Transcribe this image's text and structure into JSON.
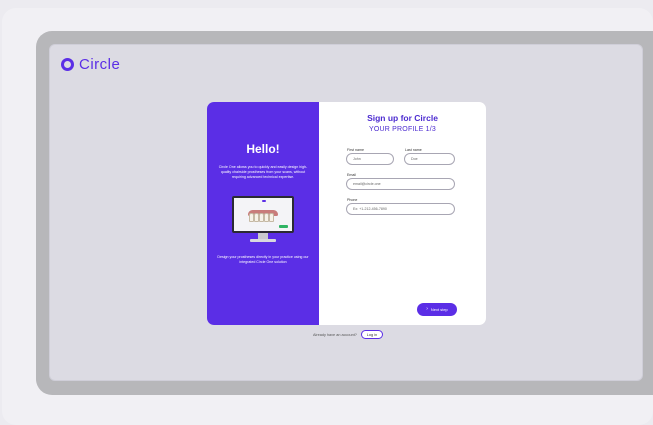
{
  "brand": {
    "name": "Circle",
    "accent": "#5b2ee6"
  },
  "left_panel": {
    "heading": "Hello!",
    "intro": "Circle One allows you to quickly and easily design high-quality chairside prostheses from your scans, without requiring advanced technical expertise.",
    "illustration": "monitor-with-dental-model",
    "footer": "Design your prostheses directly in your practice using our integrated Circle One solution"
  },
  "form": {
    "title": "Sign up for Circle",
    "subtitle": "YOUR PROFILE 1/3",
    "first_name": {
      "label": "First name",
      "value": "John"
    },
    "last_name": {
      "label": "Last name",
      "value": "Doe"
    },
    "email": {
      "label": "Email",
      "value": "email@circle.one"
    },
    "phone": {
      "label": "Phone",
      "placeholder": "Ex: +1-212-456-7890"
    },
    "next_label": "Next step",
    "next_icon": "chevron-right-icon"
  },
  "footer": {
    "account_text": "Already have an account?",
    "login_label": "Log in"
  }
}
